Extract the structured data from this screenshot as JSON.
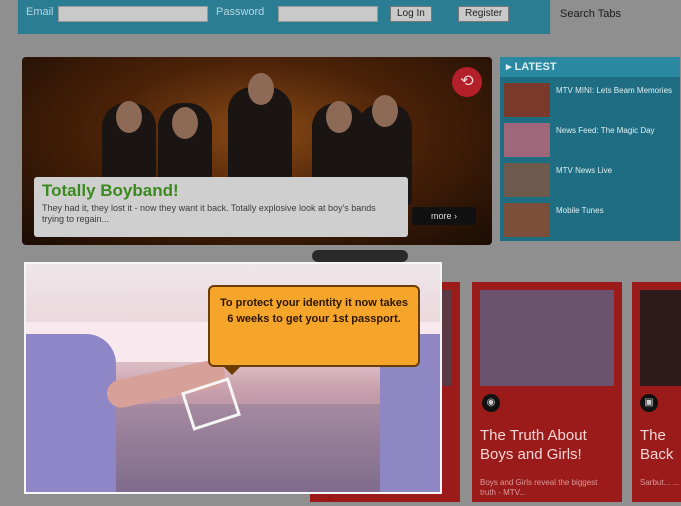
{
  "login": {
    "username_label": "Email",
    "password_label": "Password",
    "login_button": "Log In",
    "register_button": "Register",
    "search_label": "Search Tabs"
  },
  "hero": {
    "title": "Totally Boyband!",
    "description": "They had it, they lost it - now they want it back. Totally explosive look at boy's bands trying to regain...",
    "more_button": "more ›"
  },
  "latest": {
    "header": "LATEST",
    "items": [
      {
        "label": "MTV MINI: Lets Beam Memories"
      },
      {
        "label": "News Feed: The Magic Day"
      },
      {
        "label": "MTV News Live"
      },
      {
        "label": "Mobile Tunes"
      }
    ]
  },
  "cards": [
    {
      "title": "The Truth About Boys and Girls!",
      "desc": "Boys and Girls reveal the biggest truth - MTV..."
    },
    {
      "title": "The Back",
      "desc": "Sarbut... ..."
    }
  ],
  "overlay": {
    "bubble_text": "To protect your identity it now takes 6 weeks to get your 1st passport.",
    "footer_text": "... a ... ..."
  },
  "colors": {
    "teal": "#2b7d93",
    "red": "#9b1b1b",
    "bubble": "#f6a52b"
  }
}
